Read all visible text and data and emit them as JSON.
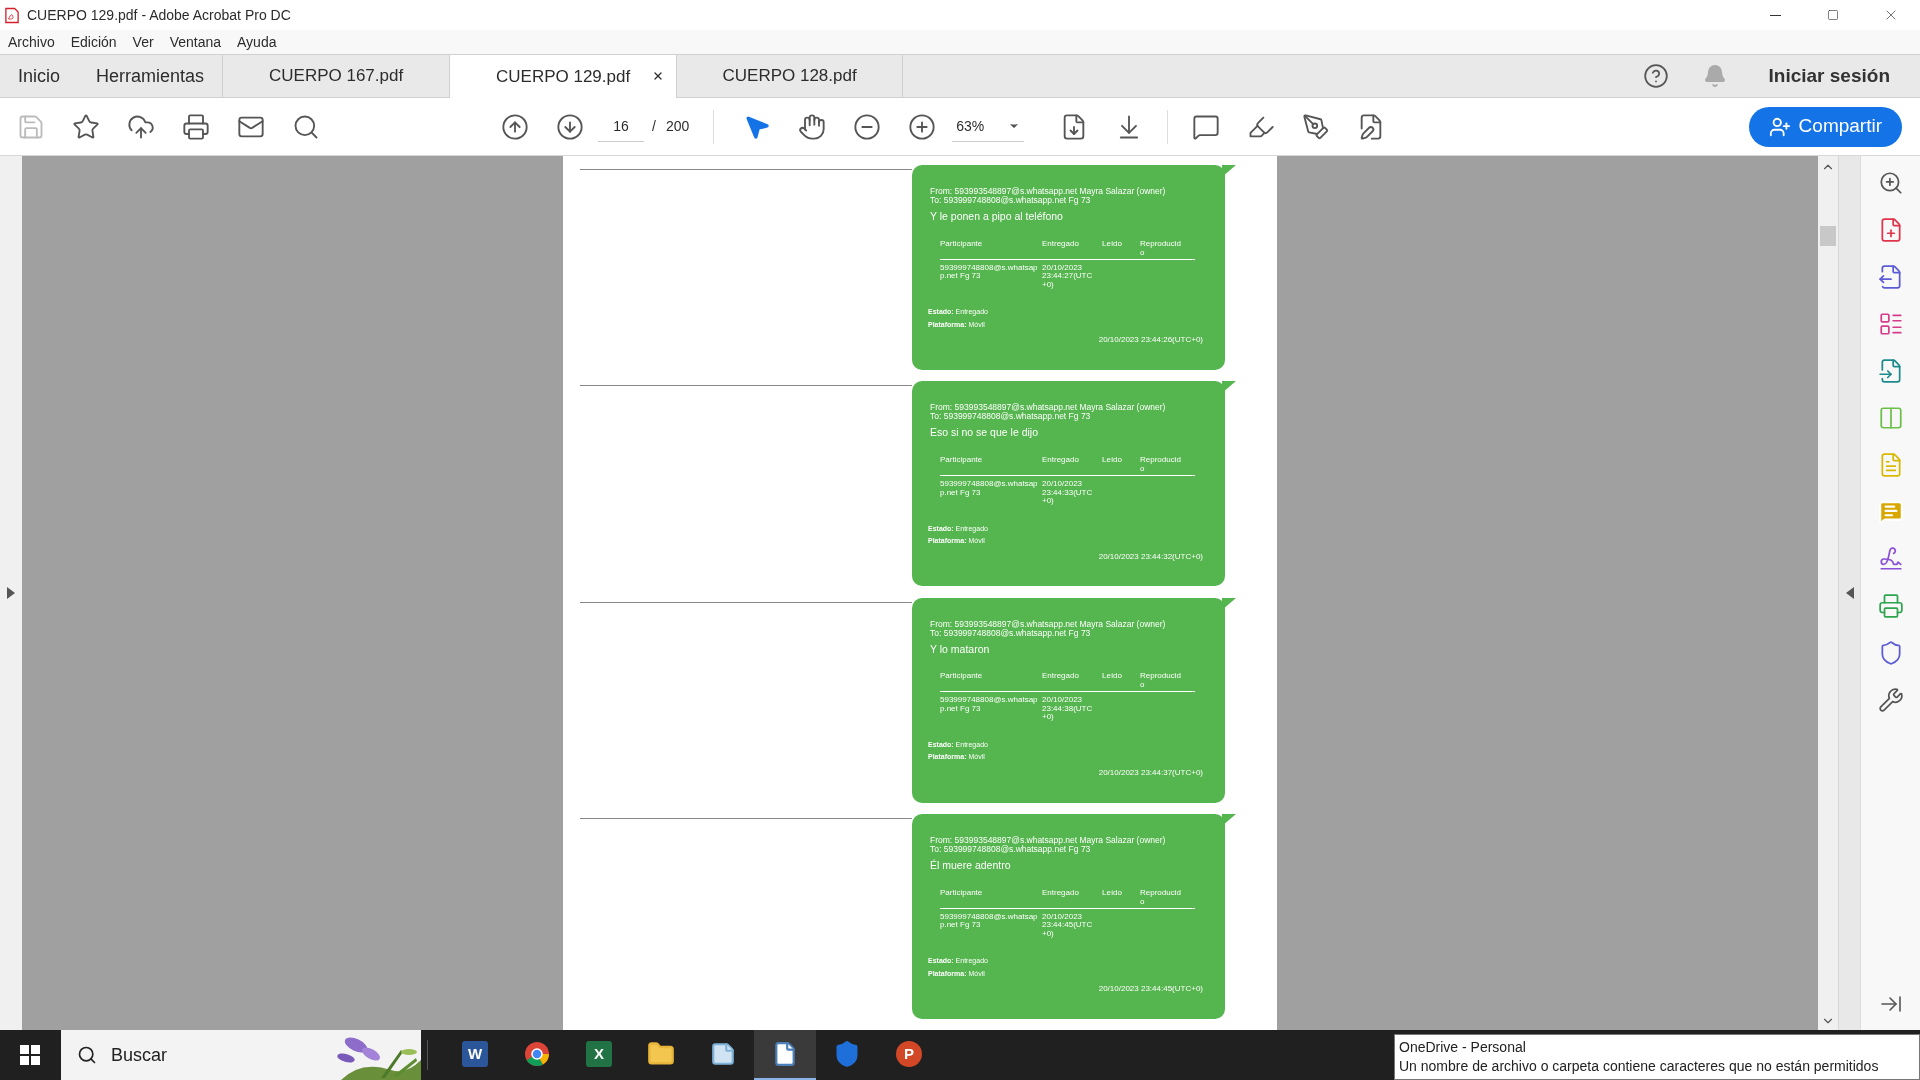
{
  "window": {
    "title": "CUERPO 129.pdf - Adobe Acrobat Pro DC"
  },
  "menu": [
    "Archivo",
    "Edición",
    "Ver",
    "Ventana",
    "Ayuda"
  ],
  "tabs": [
    {
      "kind": "nav",
      "label": "Inicio",
      "selected": false
    },
    {
      "kind": "nav",
      "label": "Herramientas",
      "selected": false
    },
    {
      "kind": "doc",
      "label": "CUERPO 167.pdf",
      "selected": false
    },
    {
      "kind": "doc",
      "label": "CUERPO 129.pdf",
      "selected": true
    },
    {
      "kind": "doc",
      "label": "CUERPO 128.pdf",
      "selected": false
    }
  ],
  "header_right": {
    "sign_in": "Iniciar sesión"
  },
  "toolbar": {
    "page_current": "16",
    "page_separator": "/",
    "page_total": "200",
    "zoom": "63%",
    "share": "Compartir"
  },
  "messages": [
    {
      "from": "From: 593993548897@s.whatsapp.net Mayra Salazar (owner)",
      "to": "To: 593999748808@s.whatsapp.net Fg 73",
      "text": "Y le ponen a pipo al teléfono",
      "columns": [
        "Participante",
        "Entregado",
        "Leído",
        "Reproducido"
      ],
      "participant": "593999748808@s.whatsapp.net Fg 73",
      "delivered": "20/10/2023 23:44:27(UTC +0)",
      "status": "**Estado:** Entregado",
      "platform": "**Plataforma:** Móvil",
      "timestamp": "20/10/2023 23:44:26(UTC+0)"
    },
    {
      "from": "From: 593993548897@s.whatsapp.net Mayra Salazar (owner)",
      "to": "To: 593999748808@s.whatsapp.net Fg 73",
      "text": "Eso si no se que le dijo",
      "columns": [
        "Participante",
        "Entregado",
        "Leído",
        "Reproducido"
      ],
      "participant": "593999748808@s.whatsapp.net Fg 73",
      "delivered": "20/10/2023 23:44:33(UTC +0)",
      "status": "**Estado:** Entregado",
      "platform": "**Plataforma:** Móvil",
      "timestamp": "20/10/2023 23:44:32(UTC+0)"
    },
    {
      "from": "From: 593993548897@s.whatsapp.net Mayra Salazar (owner)",
      "to": "To: 593999748808@s.whatsapp.net Fg 73",
      "text": "Y lo mataron",
      "columns": [
        "Participante",
        "Entregado",
        "Leído",
        "Reproducido"
      ],
      "participant": "593999748808@s.whatsapp.net Fg 73",
      "delivered": "20/10/2023 23:44:38(UTC +0)",
      "status": "**Estado:** Entregado",
      "platform": "**Plataforma:** Móvil",
      "timestamp": "20/10/2023 23:44:37(UTC+0)"
    },
    {
      "from": "From: 593993548897@s.whatsapp.net Mayra Salazar (owner)",
      "to": "To: 593999748808@s.whatsapp.net Fg 73",
      "text": "Él muere adentro",
      "columns": [
        "Participante",
        "Entregado",
        "Leído",
        "Reproducido"
      ],
      "participant": "593999748808@s.whatsapp.net Fg 73",
      "delivered": "20/10/2023 23:44:45(UTC +0)",
      "status": "**Estado:** Entregado",
      "platform": "**Plataforma:** Móvil",
      "timestamp": "20/10/2023 23:44:45(UTC+0)"
    }
  ],
  "taskbar": {
    "search_placeholder": "Buscar",
    "apps": [
      {
        "kind": "word",
        "label": "W"
      },
      {
        "kind": "chrome"
      },
      {
        "kind": "excel",
        "label": "X"
      },
      {
        "kind": "folder"
      },
      {
        "kind": "notepad"
      },
      {
        "kind": "acrobat",
        "selected": true
      },
      {
        "kind": "defender"
      },
      {
        "kind": "powerpoint",
        "label": "P"
      }
    ]
  },
  "notification": {
    "title": "OneDrive - Personal",
    "body": "Un nombre de archivo o carpeta contiene caracteres que no están permitidos"
  }
}
